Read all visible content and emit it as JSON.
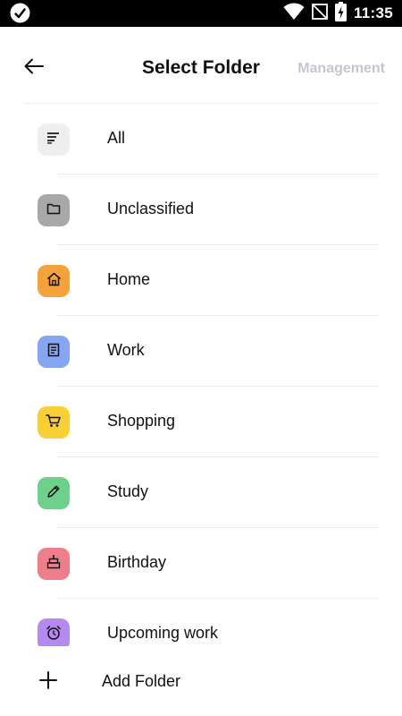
{
  "status_bar": {
    "time": "11:35",
    "icons": [
      "check-badge-icon",
      "wifi-icon",
      "no-signal-icon",
      "battery-charging-icon"
    ]
  },
  "header": {
    "title": "Select Folder",
    "management_label": "Management",
    "back_icon": "arrow-left-icon"
  },
  "folders": [
    {
      "label": "All",
      "icon": "list-icon",
      "color": "#eeeeee"
    },
    {
      "label": "Unclassified",
      "icon": "folder-icon",
      "color": "#a8a8a8"
    },
    {
      "label": "Home",
      "icon": "house-icon",
      "color": "#f5a23b"
    },
    {
      "label": "Work",
      "icon": "document-icon",
      "color": "#86a6f4"
    },
    {
      "label": "Shopping",
      "icon": "cart-icon",
      "color": "#f9cf35"
    },
    {
      "label": "Study",
      "icon": "pencil-icon",
      "color": "#6dd18c"
    },
    {
      "label": "Birthday",
      "icon": "cake-icon",
      "color": "#ee7e8a"
    },
    {
      "label": "Upcoming work",
      "icon": "alarm-clock-icon",
      "color": "#b58af0"
    }
  ],
  "add_folder": {
    "label": "Add Folder",
    "icon": "plus-icon"
  }
}
